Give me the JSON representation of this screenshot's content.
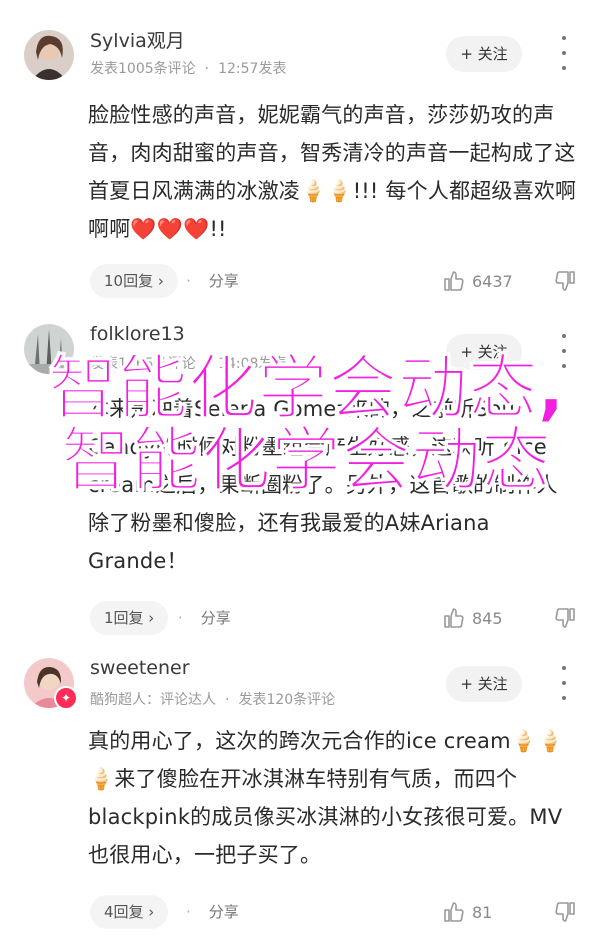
{
  "comments": [
    {
      "username": "Sylvia观月",
      "meta": [
        "发表1005条评论",
        "12:57发表"
      ],
      "follow_label": "+ 关注",
      "text": "脸脸性感的声音，妮妮霸气的声音，莎莎奶攻的声音，肉肉甜蜜的声音，智秀清冷的声音一起构成了这首夏日风满满的冰激凌🍦🍦!!! 每个人都超级喜欢啊啊啊❤️❤️❤️!!",
      "reply_label": "10回复 ›",
      "share_label": "分享",
      "like_count": "6437"
    },
    {
      "username": "folklore13",
      "meta": [
        "发表1165条评论",
        "14:08发表"
      ],
      "follow_label": "+ 关注",
      "text": "本来是冲着Selena Gomez来的，之前听Sour Candy的时候对粉墨组合产生好感，这次听了ice cream之后，果断圈粉了。另外，这首歌的制作人除了粉墨和傻脸，还有我最爱的A妹Ariana Grande！",
      "reply_label": "1回复 ›",
      "share_label": "分享",
      "like_count": "845"
    },
    {
      "username": "sweetener",
      "meta": [
        "酷狗超人：评论达人",
        "发表120条评论"
      ],
      "follow_label": "+ 关注",
      "text": "真的用心了，这次的跨次元合作的ice cream🍦🍦🍦来了傻脸在开冰淇淋车特别有气质，而四个blackpink的成员像买冰淇淋的小女孩很可爱。MV也很用心，一把子买了。",
      "reply_label": "4回复 ›",
      "share_label": "分享",
      "like_count": "81"
    }
  ],
  "watermark": "智能化学会动态,智能化学会动态",
  "colors": {
    "watermark": "#f21fe0",
    "badge": "#ff2d55"
  }
}
